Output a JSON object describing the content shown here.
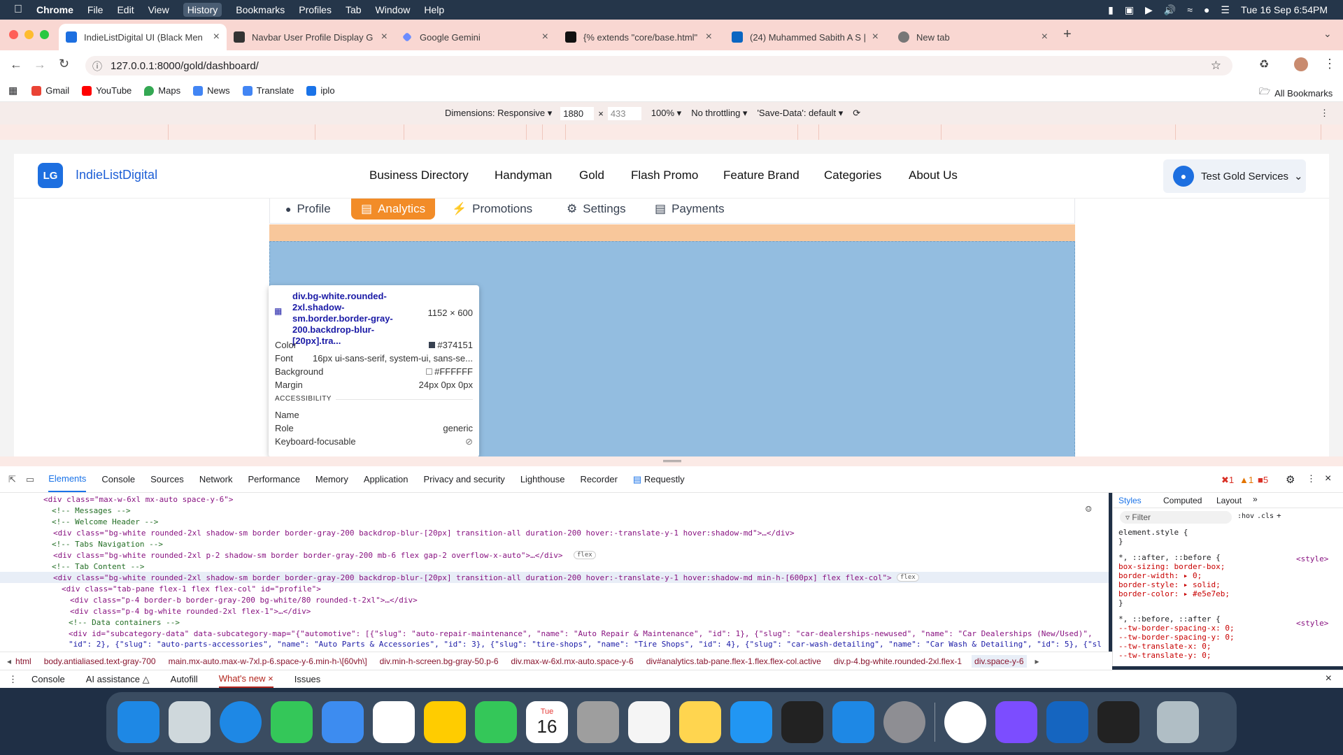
{
  "menubar": {
    "app": "Chrome",
    "items": [
      "File",
      "Edit",
      "View",
      "History",
      "Bookmarks",
      "Profiles",
      "Tab",
      "Window",
      "Help"
    ],
    "datetime": "Tue 16 Sep  6:54PM"
  },
  "tabs": [
    {
      "title": "IndieListDigital UI (Black Men",
      "color": "#1d6fe0"
    },
    {
      "title": "Navbar User Profile Display G",
      "color": "#333333"
    },
    {
      "title": "Google Gemini",
      "color": "#6b8cff"
    },
    {
      "title": "{% extends \"core/base.html\"",
      "color": "#111111"
    },
    {
      "title": "(24) Muhammed Sabith A S |",
      "color": "#0a66c2"
    },
    {
      "title": "New tab",
      "color": "#777777"
    }
  ],
  "omnibox": {
    "url": "127.0.0.1:8000/gold/dashboard/"
  },
  "bookmarks": [
    {
      "label": "Gmail",
      "color": "#ea4335"
    },
    {
      "label": "YouTube",
      "color": "#ff0000"
    },
    {
      "label": "Maps",
      "color": "#34a853"
    },
    {
      "label": "News",
      "color": "#4285f4"
    },
    {
      "label": "Translate",
      "color": "#4285f4"
    },
    {
      "label": "iplo",
      "color": "#1a73e8"
    }
  ],
  "all_bookmarks": "All Bookmarks",
  "device_toolbar": {
    "dimensions": "Dimensions: Responsive",
    "width": "1880",
    "height": "433",
    "zoom": "100%",
    "throttling": "No throttling",
    "save_data": "'Save-Data': default"
  },
  "site": {
    "logo": "LG",
    "brand": "IndieListDigital",
    "nav": [
      "Business Directory",
      "Handyman",
      "Gold",
      "Flash Promo",
      "Feature Brand",
      "Categories",
      "About Us"
    ],
    "user": "Test Gold Services",
    "profile_tabs": [
      "Profile",
      "Analytics",
      "Promotions",
      "Settings",
      "Payments"
    ],
    "active_tab": "Analytics"
  },
  "tooltip": {
    "selector": "div.bg-white.rounded-2xl.shadow-sm.border.border-gray-200.backdrop-blur-[20px].tra...",
    "size": "1152 × 600",
    "rows": [
      {
        "label": "Color",
        "value": "#374151"
      },
      {
        "label": "Font",
        "value": "16px ui-sans-serif, system-ui, sans-se..."
      },
      {
        "label": "Background",
        "value": "#FFFFFF"
      },
      {
        "label": "Margin",
        "value": "24px 0px 0px"
      }
    ],
    "accessibility_header": "ACCESSIBILITY",
    "acc_rows": [
      {
        "label": "Name",
        "value": ""
      },
      {
        "label": "Role",
        "value": "generic"
      },
      {
        "label": "Keyboard-focusable",
        "value": ""
      }
    ]
  },
  "devtools": {
    "tabs": [
      "Elements",
      "Console",
      "Sources",
      "Network",
      "Performance",
      "Memory",
      "Application",
      "Privacy and security",
      "Lighthouse",
      "Recorder",
      "Requestly"
    ],
    "counts": {
      "errors": "1",
      "warnings": "1",
      "issues": "5"
    },
    "dom_lines": [
      "<div class=\"max-w-6xl mx-auto space-y-6\">",
      "<!-- Messages -->",
      "<!-- Welcome Header -->",
      "<div class=\"bg-white rounded-2xl shadow-sm border border-gray-200 backdrop-blur-[20px] transition-all duration-200 hover:-translate-y-1 hover:shadow-md\">…</div>",
      "<!-- Tabs Navigation -->",
      "<div class=\"bg-white rounded-2xl p-2 shadow-sm border border-gray-200 mb-6 flex gap-2 overflow-x-auto\">…</div>",
      "<!-- Tab Content -->",
      "<div class=\"bg-white rounded-2xl shadow-sm border border-gray-200 backdrop-blur-[20px] transition-all duration-200 hover:-translate-y-1 hover:shadow-md min-h-[600px] flex flex-col\">",
      "<div class=\"tab-pane flex-1 flex flex-col\" id=\"profile\">",
      "<div class=\"p-4 border-b border-gray-200 bg-white/80 rounded-t-2xl\">…</div>",
      "<div class=\"p-4 bg-white rounded-2xl flex-1\">…</div>",
      "<!-- Data containers -->",
      "<div id=\"subcategory-data\" data-subcategory-map=\"{\"automotive\": [{\"slug\": \"auto-repair-maintenance\", \"name\": \"Auto Repair & Maintenance\", \"id\": 1}, {\"slug\": \"car-dealerships-newused\", \"name\": \"Car Dealerships (New/Used)\",",
      "\"id\": 2}, {\"slug\": \"auto-parts-accessories\", \"name\": \"Auto Parts & Accessories\", \"id\": 3}, {\"slug\": \"tire-shops\", \"name\": \"Tire Shops\", \"id\": 4}, {\"slug\": \"car-wash-detailing\", \"name\": \"Car Wash & Detailing\", \"id\": 5}, {\"sl"
    ],
    "flex_badge": "flex",
    "styles_tabs": [
      "Styles",
      "Computed",
      "Layout"
    ],
    "filter": "Filter",
    "styles_text": [
      "element.style {",
      "}",
      "*, ::after, ::before {",
      "  box-sizing: border-box;",
      "  border-width: ▸ 0;",
      "  border-style: ▸ solid;",
      "  border-color: ▸ #e5e7eb;",
      "}",
      "*, ::before, ::after {",
      "  --tw-border-spacing-x: 0;",
      "  --tw-border-spacing-y: 0;",
      "  --tw-translate-x: 0;",
      "  --tw-translate-y: 0;"
    ],
    "style_source": "<style>",
    "breadcrumbs": [
      "html",
      "body.antialiased.text-gray-700",
      "main.mx-auto.max-w-7xl.p-6.space-y-6.min-h-\\[60vh\\]",
      "div.min-h-screen.bg-gray-50.p-6",
      "div.max-w-6xl.mx-auto.space-y-6",
      "div#analytics.tab-pane.flex-1.flex.flex-col.active",
      "div.p-4.bg-white.rounded-2xl.flex-1",
      "div.space-y-6"
    ],
    "drawer": [
      "Console",
      "AI assistance",
      "Autofill",
      "What's new",
      "Issues"
    ]
  },
  "dock_colors": [
    "#1e88e5",
    "#cfd8dc",
    "#1e88e5",
    "#34c759",
    "#3d8cf0",
    "#ffffff",
    "#ffcc00",
    "#34c759",
    "#ffffff",
    "#9e9e9e",
    "#f5f5f5",
    "#ffd54f",
    "#2196f3",
    "#222222",
    "#1e88e5",
    "#8e8e93",
    "#ffffff",
    "#7c4dff",
    "#1565c0",
    "#222222",
    "#b0bec5"
  ],
  "dock_calendar": {
    "day": "Tue",
    "date": "16"
  }
}
